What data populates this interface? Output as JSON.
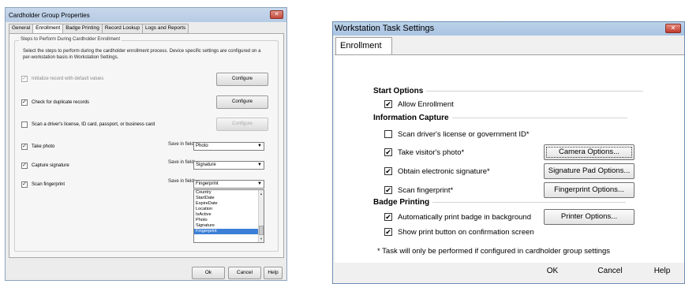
{
  "left_dialog": {
    "title": "Cardholder Group Properties",
    "close_glyph": "✕",
    "tabs": [
      "General",
      "Enrollment",
      "Badge Printing",
      "Record Lookup",
      "Logs and Reports"
    ],
    "active_tab": "Enrollment",
    "group_title": "Steps to Perform During Cardholder Enrollment",
    "description": "Select the steps to perform during the cardholder enrollment process. Device specific settings are configured on a per-workstation basis in Workstation Settings.",
    "rows": [
      {
        "label": "Initialize record with default values",
        "checked": true,
        "disabled": true,
        "button": "Configure",
        "button_disabled": false
      },
      {
        "label": "Check for duplicate records",
        "checked": true,
        "disabled": false,
        "button": "Configure",
        "button_disabled": false
      },
      {
        "label": "Scan a driver's license, ID card, passport, or business card",
        "checked": false,
        "disabled": false,
        "button": "Configure",
        "button_disabled": true
      },
      {
        "label": "Take photo",
        "checked": true,
        "disabled": false,
        "save_label": "Save in field:",
        "field": "Photo"
      },
      {
        "label": "Capture signature",
        "checked": true,
        "disabled": false,
        "save_label": "Save in field:",
        "field": "Signature"
      },
      {
        "label": "Scan fingerprint",
        "checked": true,
        "disabled": false,
        "save_label": "Save in field:",
        "field": "Fingerprint"
      }
    ],
    "dropdown_options": [
      "Country",
      "StartDate",
      "ExpireDate",
      "Location",
      "IsActive",
      "Photo",
      "Signature",
      "Fingerprint"
    ],
    "dropdown_selected": "Fingerprint",
    "bottom_buttons": [
      "Ok",
      "Cancel",
      "Help"
    ]
  },
  "right_dialog": {
    "title": "Workstation Task Settings",
    "close_glyph": "✕",
    "tab": "Enrollment",
    "sections": {
      "start": "Start Options",
      "info": "Information Capture",
      "badge": "Badge Printing"
    },
    "allow_enrollment": "Allow Enrollment",
    "scan_license": "Scan driver's license or government ID*",
    "take_photo": "Take visitor's photo*",
    "signature": "Obtain electronic signature*",
    "fingerprint": "Scan fingerprint*",
    "auto_print": "Automatically print badge in background",
    "show_print": "Show print button on confirmation screen",
    "camera_btn": "Camera Options...",
    "sigpad_btn": "Signature Pad Options...",
    "fp_btn": "Fingerprint Options...",
    "printer_btn": "Printer Options...",
    "note": "* Task will only be performed if configured in cardholder group settings",
    "ok": "OK",
    "cancel": "Cancel",
    "help": "Help",
    "check_glyph": "✔"
  }
}
